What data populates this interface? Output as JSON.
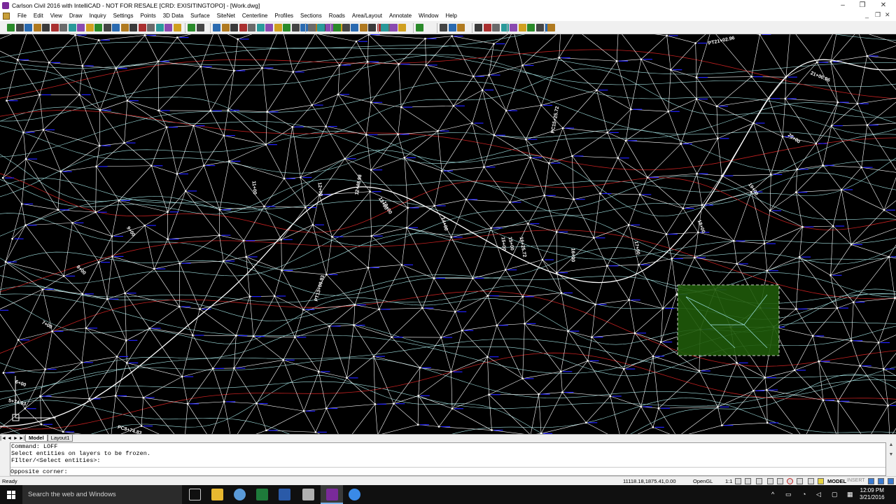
{
  "window": {
    "title": "Carlson Civil 2016 with IntelliCAD - NOT FOR RESALE [CRD: EXISITINGTOPO] - [Work.dwg]",
    "minimize": "–",
    "restore": "❐",
    "close": "✕"
  },
  "menu": {
    "items": [
      "File",
      "Edit",
      "View",
      "Draw",
      "Inquiry",
      "Settings",
      "Points",
      "3D Data",
      "Surface",
      "SiteNet",
      "Centerline",
      "Profiles",
      "Sections",
      "Roads",
      "Area/Layout",
      "Annotate",
      "Window",
      "Help"
    ],
    "doc_minimize": "_",
    "doc_restore": "❐",
    "doc_close": "✕"
  },
  "drawing": {
    "background": "#000000",
    "tin_color": "#ffffff",
    "contour_color": "#a0e0e0",
    "index_contour_color": "#c02020",
    "tick_color": "#2020ff",
    "selection_fill": "#1f5a0a",
    "station_labels": [
      "PT21+02.96",
      "21+00.96",
      "20+00",
      "19+00",
      "18+00",
      "17+00",
      "16+00",
      "15+00",
      "16+25.72",
      "15+00",
      "14+00",
      "13+00",
      "12+00",
      "11+00",
      "PC15+25.72",
      "12+48.98",
      "10+00",
      "9+00",
      "8+00",
      "7+00",
      "6+00",
      "5+74.03",
      "PT13+00.93",
      "PC8+74.83"
    ]
  },
  "layout_tabs": {
    "nav": [
      "|◄",
      "◄",
      "►",
      "►|"
    ],
    "tabs": [
      "Model",
      "Layout1"
    ]
  },
  "command": {
    "lines": [
      "Command: LOFF",
      "Select entities on layers to be frozen.",
      "FIlter/<Select entities>:"
    ],
    "prompt": "Opposite corner:"
  },
  "status": {
    "ready": "Ready",
    "coordinates": "11118.18,1875.41,0.00",
    "opengl": "OpenGL",
    "scale": "1:1",
    "model": "MODEL",
    "insert": "INSERT"
  },
  "taskbar": {
    "search_placeholder": "Search the web and Windows",
    "time": "12:09 PM",
    "date": "3/21/2016"
  }
}
